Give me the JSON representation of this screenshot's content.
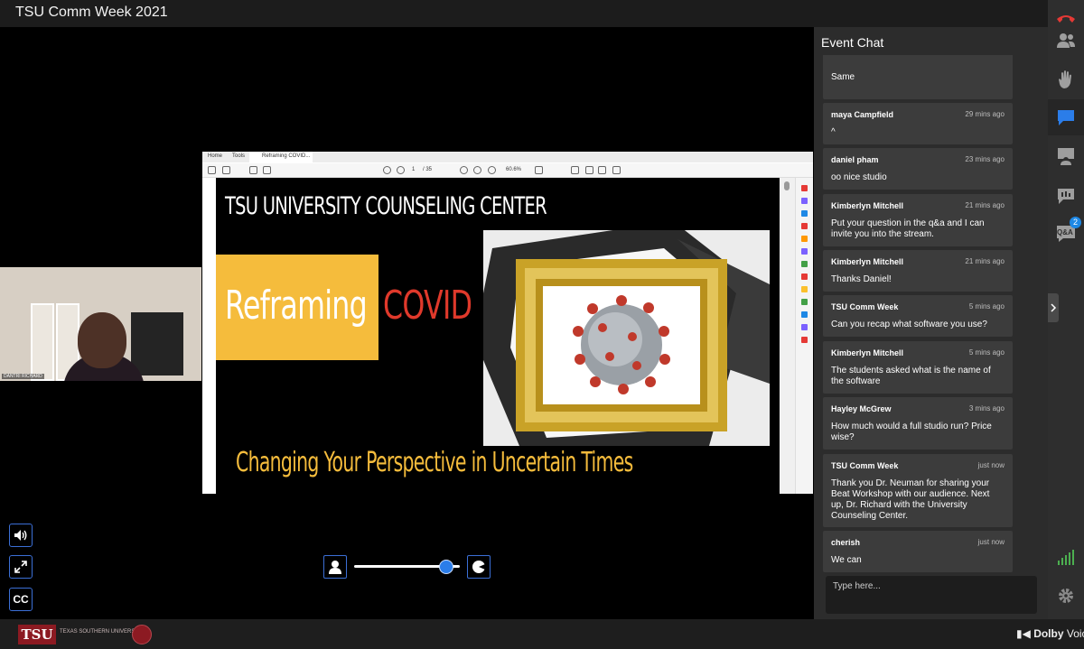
{
  "app": {
    "title": "TSU Comm Week 2021"
  },
  "colors": {
    "accent": "#2b7de9",
    "end_call": "#e53935",
    "signal": "#4caf50"
  },
  "rail": {
    "icons": [
      "phone-hangup-icon",
      "participants-icon",
      "raise-hand-icon",
      "chat-icon",
      "presenter-icon",
      "feedback-icon",
      "qa-icon",
      "signal-icon",
      "settings-icon"
    ],
    "qa_label": "Q&A",
    "qa_badge": "2"
  },
  "camera": {
    "name": "DANTRI RICHARD"
  },
  "shared_screen": {
    "tabs": [
      "Home",
      "Tools",
      "Reframing COVID..."
    ],
    "page_current": "1",
    "page_total": "/ 35",
    "zoom": "60.6%",
    "slide": {
      "heading": "TSU UNIVERSITY COUNSELING CENTER",
      "title_white": "Reframing",
      "title_red": "COVID",
      "tagline": "Changing Your Perspective in Uncertain Times"
    }
  },
  "controls": {
    "volume_icon": "speaker-icon",
    "fullscreen_icon": "expand-icon",
    "captions_label": "CC",
    "layout_left_icon": "person-icon",
    "layout_right_icon": "screen-share-icon",
    "layout_mix": 0.87
  },
  "chat": {
    "title": "Event Chat",
    "messages": [
      {
        "author": "",
        "time": "",
        "text": "Same"
      },
      {
        "author": "maya Campfield",
        "time": "29 mins ago",
        "text": "^"
      },
      {
        "author": "daniel pham",
        "time": "23 mins ago",
        "text": "oo nice studio"
      },
      {
        "author": "Kimberlyn Mitchell",
        "time": "21 mins ago",
        "text": "Put your question in the q&a and I can invite you into the stream."
      },
      {
        "author": "Kimberlyn Mitchell",
        "time": "21 mins ago",
        "text": "Thanks Daniel!"
      },
      {
        "author": "TSU Comm Week",
        "time": "5 mins ago",
        "text": "Can you recap what software you use?"
      },
      {
        "author": "Kimberlyn Mitchell",
        "time": "5 mins ago",
        "text": "The students asked what is the name of the software"
      },
      {
        "author": "Hayley McGrew",
        "time": "3 mins ago",
        "text": "How much would a full studio run? Price wise?"
      },
      {
        "author": "TSU Comm Week",
        "time": "just now",
        "text": "Thank you Dr. Neuman for sharing your Beat Workshop with our audience. Next up, Dr. Richard with the University Counseling Center."
      },
      {
        "author": "cherish",
        "time": "just now",
        "text": "We can"
      }
    ],
    "input_placeholder": "Type here..."
  },
  "footer": {
    "university_mark": "TSU",
    "university_name": "TEXAS SOUTHERN UNIVERSITY",
    "brand_light": "Dolby",
    "brand_suffix": "Voice"
  }
}
